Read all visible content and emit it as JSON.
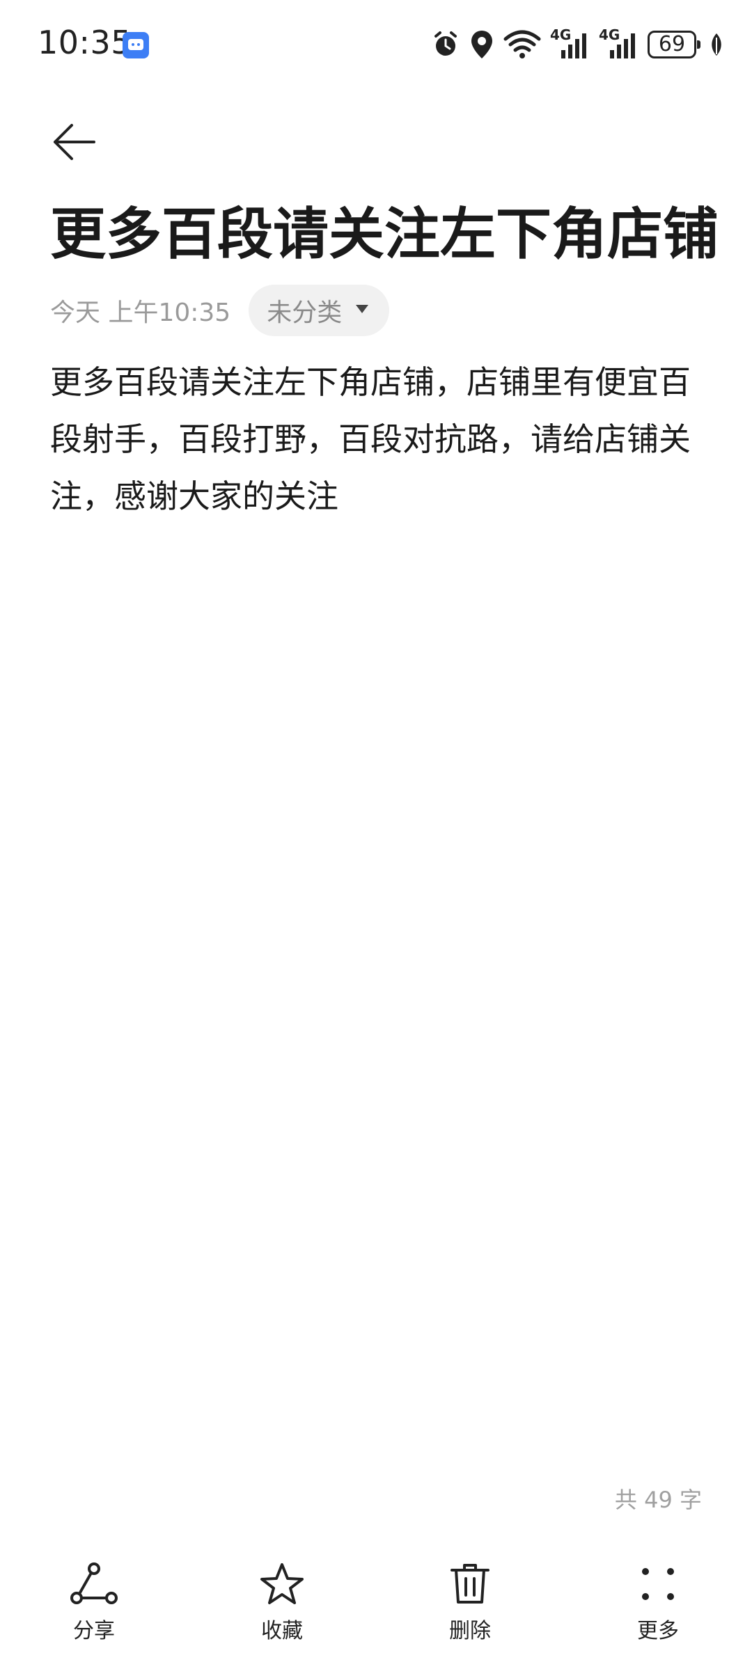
{
  "status_bar": {
    "time": "10:35",
    "network_1": "4G",
    "network_2": "4G",
    "battery": "69"
  },
  "note": {
    "title": "更多百段请关注左下角店铺",
    "date": "今天 上午10:35",
    "category": "未分类",
    "body": "更多百段请关注左下角店铺，店铺里有便宜百段射手，百段打野，百段对抗路，请给店铺关注，感谢大家的关注",
    "word_count": "共 49 字"
  },
  "toolbar": {
    "share": "分享",
    "favorite": "收藏",
    "delete": "删除",
    "more": "更多"
  },
  "icons": {
    "back": "arrow-left-icon",
    "app_notification": "chat-app-icon",
    "alarm": "alarm-icon",
    "location": "location-icon",
    "wifi": "wifi-icon",
    "signal": "signal-icon",
    "battery": "battery-icon",
    "leaf": "leaf-icon",
    "category_dropdown": "triangle-down-icon",
    "share": "share-icon",
    "favorite": "star-icon",
    "delete": "trash-icon",
    "more": "dots-icon"
  }
}
